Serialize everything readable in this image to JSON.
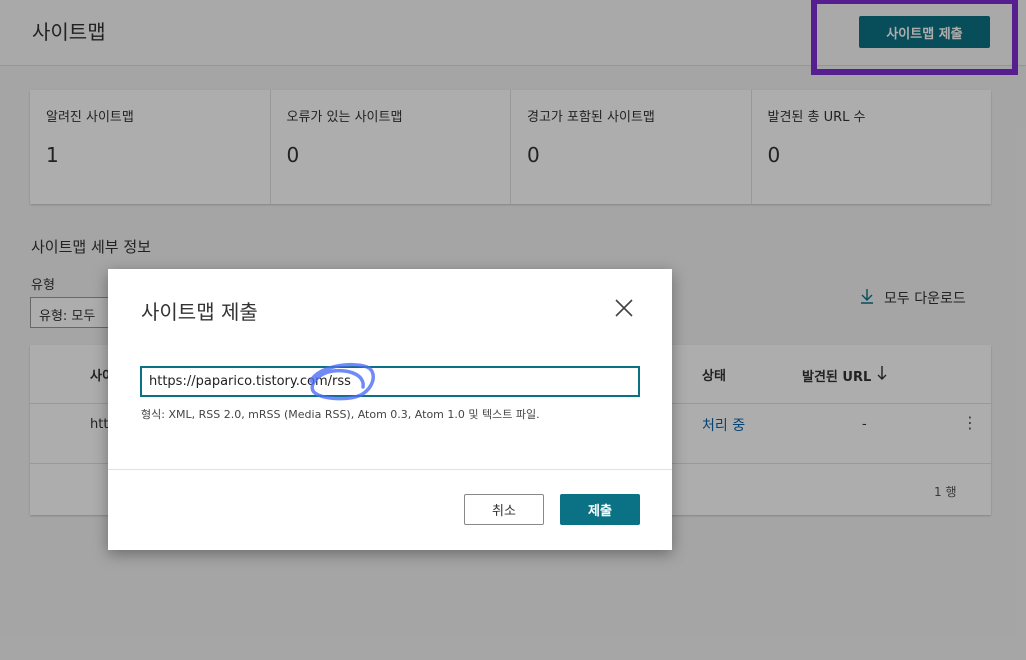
{
  "header": {
    "title": "사이트맵",
    "submit_button": "사이트맵 제출"
  },
  "stats": [
    {
      "label": "알려진 사이트맵",
      "value": "1"
    },
    {
      "label": "오류가 있는 사이트맵",
      "value": "0"
    },
    {
      "label": "경고가 포함된 사이트맵",
      "value": "0"
    },
    {
      "label": "발견된 총 URL 수",
      "value": "0"
    }
  ],
  "details": {
    "title": "사이트맵 세부 정보",
    "filter_label": "유형",
    "filter_value": "유형: 모두",
    "download_all": "모두 다운로드",
    "columns": {
      "sitemap": "사이",
      "status": "상태",
      "discovered_urls": "발견된 URL"
    },
    "rows": [
      {
        "url": "htt",
        "status": "처리 중",
        "count": "-"
      }
    ],
    "row_count": "1 행"
  },
  "dialog": {
    "title": "사이트맵 제출",
    "input_value": "https://paparico.tistory.com/rss",
    "hint": "형식: XML, RSS 2.0, mRSS (Media RSS), Atom 0.3, Atom 1.0 및 텍스트 파일.",
    "cancel": "취소",
    "submit": "제출"
  },
  "colors": {
    "accent": "#0b7285",
    "highlight": "#7f2dd3",
    "link": "#0b63a8"
  },
  "icons": {
    "close": "close-icon",
    "download": "download-icon",
    "sort": "arrow-down-icon",
    "more": "more-vertical-icon"
  }
}
